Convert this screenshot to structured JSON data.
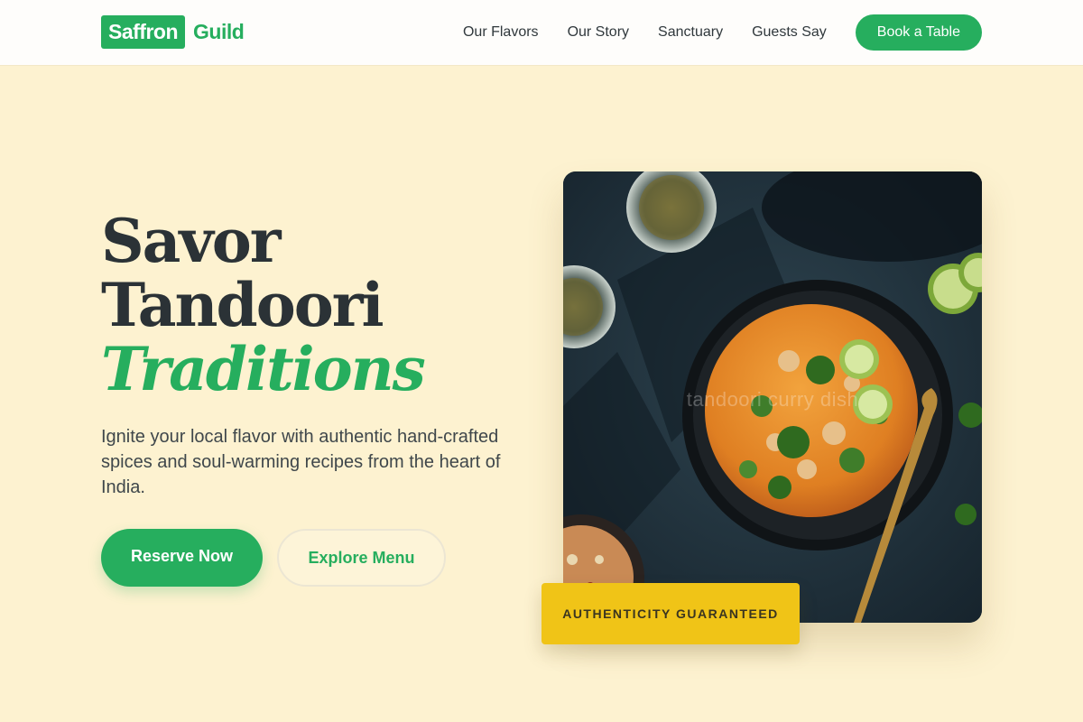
{
  "header": {
    "logo_box": "Saffron",
    "logo_rest": "Guild",
    "nav": [
      {
        "label": "Our Flavors"
      },
      {
        "label": "Our Story"
      },
      {
        "label": "Sanctuary"
      },
      {
        "label": "Guests Say"
      }
    ],
    "cta_label": "Book a Table"
  },
  "hero": {
    "title_line1": "Savor",
    "title_line2": "Tandoori",
    "title_accent": "Traditions",
    "subtitle": "Ignite your local flavor with authentic hand-crafted spices and soul-warming recipes from the heart of India.",
    "primary_label": "Reserve Now",
    "secondary_label": "Explore Menu",
    "image_watermark": "tandoori curry dish",
    "badge_label": "AUTHENTICITY GUARANTEED"
  },
  "colors": {
    "brand_green": "#26ae5e",
    "background_cream": "#fdf2d0",
    "badge_yellow": "#f0c417",
    "text_dark": "#2b3236"
  }
}
